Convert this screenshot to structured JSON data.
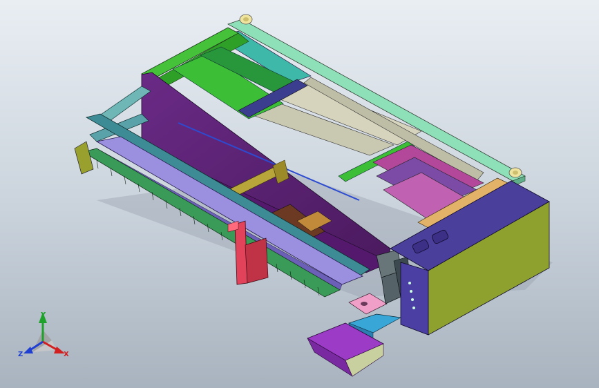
{
  "viewport": {
    "background_top": "#e9eef3",
    "background_bottom": "#a8b3bf"
  },
  "triad": {
    "x_label": "X",
    "y_label": "Y",
    "z_label": "Z",
    "x_color": "#d21f1f",
    "y_color": "#1fa22b",
    "z_color": "#1f3fd2"
  },
  "model": {
    "icons": [
      "cad-assembly-model",
      "coordinate-triad-icon"
    ]
  }
}
